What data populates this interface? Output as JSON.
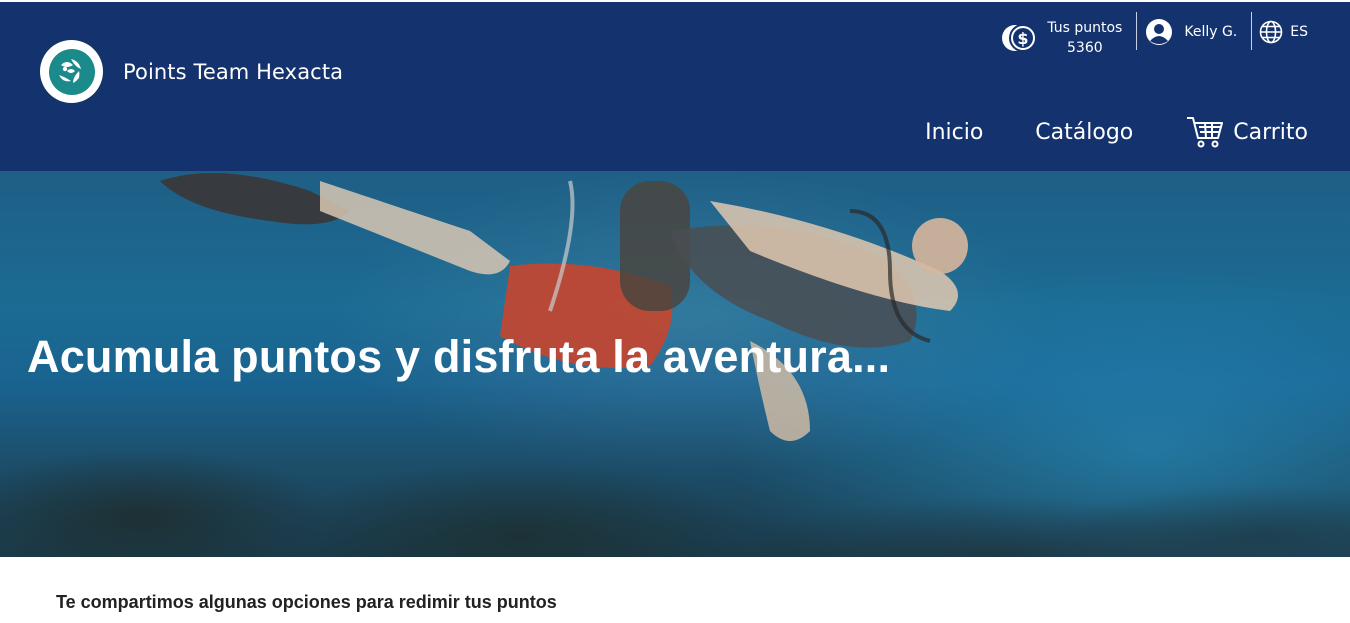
{
  "header": {
    "brand_name": "Points Team Hexacta",
    "points_label": "Tus puntos",
    "points_value": "5360",
    "user_name": "Kelly G.",
    "language": "ES",
    "nav": {
      "home": "Inicio",
      "catalog": "Catálogo",
      "cart": "Carrito"
    }
  },
  "hero": {
    "title": "Acumula puntos y disfruta la aventura..."
  },
  "content": {
    "section_title": "Te compartimos algunas opciones para redimir tus puntos"
  },
  "colors": {
    "header_bg": "#14336e",
    "logo_teal": "#1a8a8a"
  },
  "icons": [
    "logo-icon",
    "coin-icon",
    "user-icon",
    "globe-icon",
    "cart-icon"
  ]
}
